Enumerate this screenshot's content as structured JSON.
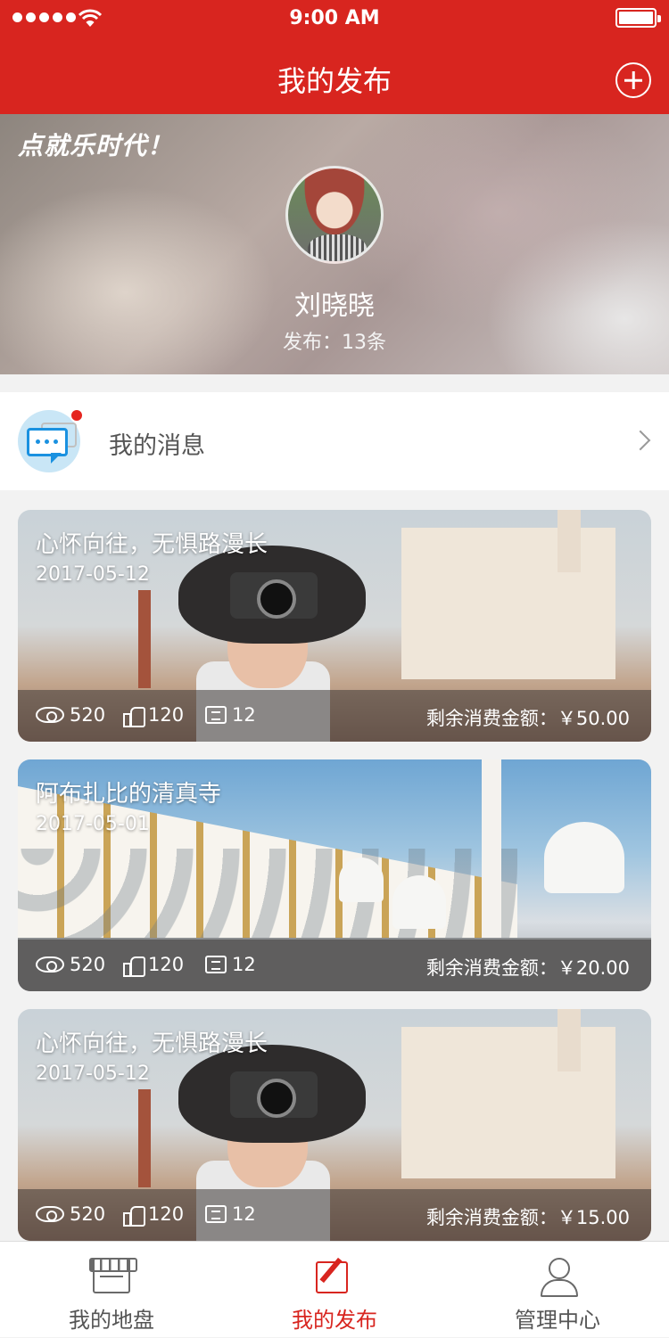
{
  "status_bar": {
    "time": "9:00 AM"
  },
  "nav": {
    "title": "我的发布"
  },
  "hero": {
    "slogan": "点就乐时代！",
    "username": "刘晓晓",
    "publish_count": "发布：13条"
  },
  "messages": {
    "label": "我的消息",
    "has_unread": true
  },
  "posts": [
    {
      "title": "心怀向往，无惧路漫长",
      "date": "2017-05-12",
      "views": "520",
      "likes": "120",
      "comments": "12",
      "remaining": "剩余消费金额：￥50.00",
      "image": "woman-with-camera"
    },
    {
      "title": "阿布扎比的清真寺",
      "date": "2017-05-01",
      "views": "520",
      "likes": "120",
      "comments": "12",
      "remaining": "剩余消费金额：￥20.00",
      "image": "mosque"
    },
    {
      "title": "心怀向往，无惧路漫长",
      "date": "2017-05-12",
      "views": "520",
      "likes": "120",
      "comments": "12",
      "remaining": "剩余消费金额：￥15.00",
      "image": "woman-with-camera"
    }
  ],
  "tabbar": {
    "tabs": [
      {
        "label": "我的地盘",
        "icon": "store-icon",
        "active": false
      },
      {
        "label": "我的发布",
        "icon": "edit-icon",
        "active": true
      },
      {
        "label": "管理中心",
        "icon": "person-icon",
        "active": false
      }
    ]
  },
  "colors": {
    "brand_red": "#d8251f",
    "message_blue": "#1a91e0"
  }
}
